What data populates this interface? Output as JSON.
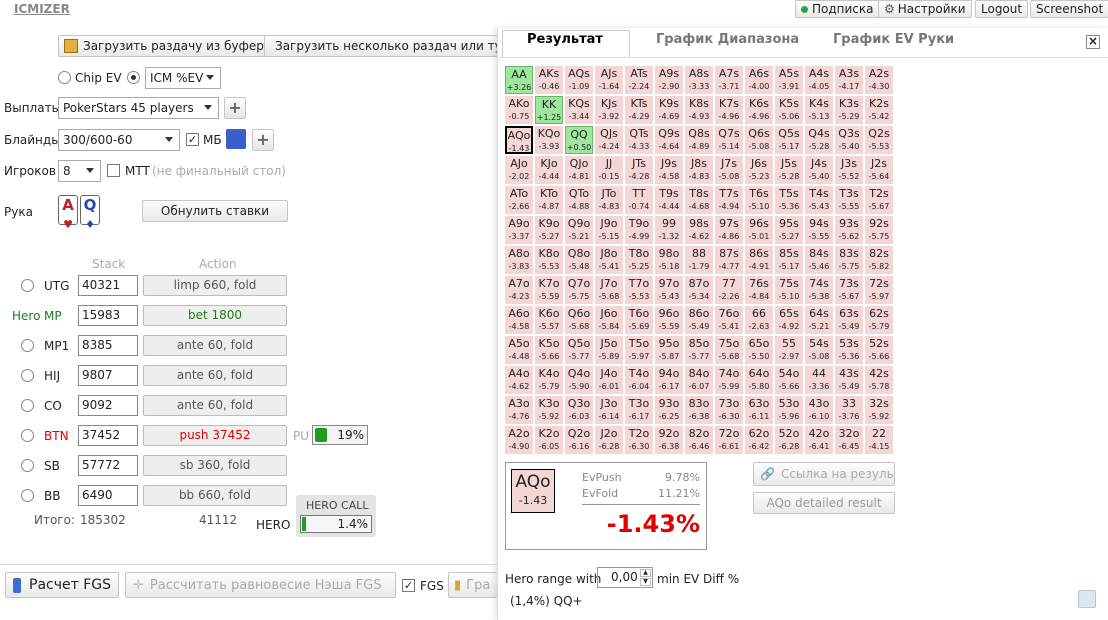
{
  "app": {
    "logo": "ICMIZER"
  },
  "topbar": {
    "subscription": "Подписка",
    "settings": "Настройки",
    "logout": "Logout",
    "screenshot": "Screenshot"
  },
  "left": {
    "load_clipboard": "Загрузить раздачу из буфера",
    "load_multiple": "Загрузить несколько раздач или тур",
    "chip_ev": "Chip EV",
    "icm_ev": "ICM %EV",
    "payouts_label": "Выплаты",
    "payouts_value": "PokerStars 45 players",
    "blinds_label": "Блайнды",
    "blinds_value": "300/600-60",
    "bb_label": "МБ",
    "players_label": "Игроков",
    "players_value": "8",
    "mtt_label": "MTT",
    "mtt_hint": "(не финальный стол)",
    "hand_label": "Рука",
    "card1": "A",
    "card2": "Q",
    "reset_bets": "Обнулить ставки",
    "col_stack": "Stack",
    "col_action": "Action",
    "hero_label": "Hero",
    "positions": [
      {
        "pos": "UTG",
        "stack": "40321",
        "action": "limp 660, fold"
      },
      {
        "pos": "MP",
        "stack": "15983",
        "action": "bet 1800"
      },
      {
        "pos": "MP1",
        "stack": "8385",
        "action": "ante 60, fold"
      },
      {
        "pos": "HIJ",
        "stack": "9807",
        "action": "ante 60, fold"
      },
      {
        "pos": "CO",
        "stack": "9092",
        "action": "ante 60, fold"
      },
      {
        "pos": "BTN",
        "stack": "37452",
        "action": "push 37452"
      },
      {
        "pos": "SB",
        "stack": "57772",
        "action": "sb 360, fold"
      },
      {
        "pos": "BB",
        "stack": "6490",
        "action": "bb 660, fold"
      }
    ],
    "pu_label": "PU",
    "pu_value": "19%",
    "total_label": "Итого:",
    "total_stack": "185302",
    "total_action": "41112",
    "hero_call_label": "HERO CALL",
    "hero_row_label": "HERO",
    "hero_value": "1.4%",
    "calc_fgs": "Расчет FGS",
    "nash_fgs": "Рассчитать равновесие Нэша FGS",
    "fgs_label": "FGS",
    "graph_label": "Гра"
  },
  "panel": {
    "tabs": [
      "Результат",
      "График Диапазона",
      "График EV Руки"
    ],
    "close": "×",
    "link_btn": "Ссылка на результат",
    "detail_btn": "AQo detailed result",
    "result": {
      "hand": "AQo",
      "hand_ev": "-1.43",
      "evpush_label": "EvPush",
      "evpush_value": "9.78%",
      "evfold_label": "EvFold",
      "evfold_value": "11.21%",
      "diff": "-1.43%"
    },
    "range_label": "Hero range with",
    "range_value": "0,00",
    "range_suffix": "min EV Diff %",
    "range_summary": "(1,4%) QQ+",
    "grid": [
      [
        [
          "AA",
          "+3.26"
        ],
        [
          "AKs",
          "-0.46"
        ],
        [
          "AQs",
          "-1.09"
        ],
        [
          "AJs",
          "-1.64"
        ],
        [
          "ATs",
          "-2.24"
        ],
        [
          "A9s",
          "-2.90"
        ],
        [
          "A8s",
          "-3.33"
        ],
        [
          "A7s",
          "-3.71"
        ],
        [
          "A6s",
          "-4.00"
        ],
        [
          "A5s",
          "-3.91"
        ],
        [
          "A4s",
          "-4.05"
        ],
        [
          "A3s",
          "-4.17"
        ],
        [
          "A2s",
          "-4.30"
        ]
      ],
      [
        [
          "AKo",
          "-0.75"
        ],
        [
          "KK",
          "+1.25"
        ],
        [
          "KQs",
          "-3.44"
        ],
        [
          "KJs",
          "-3.92"
        ],
        [
          "KTs",
          "-4.29"
        ],
        [
          "K9s",
          "-4.69"
        ],
        [
          "K8s",
          "-4.93"
        ],
        [
          "K7s",
          "-4.96"
        ],
        [
          "K6s",
          "-4.96"
        ],
        [
          "K5s",
          "-5.06"
        ],
        [
          "K4s",
          "-5.13"
        ],
        [
          "K3s",
          "-5.29"
        ],
        [
          "K2s",
          "-5.42"
        ]
      ],
      [
        [
          "AQo",
          "-1.43"
        ],
        [
          "KQo",
          "-3.93"
        ],
        [
          "QQ",
          "+0.50"
        ],
        [
          "QJs",
          "-4.24"
        ],
        [
          "QTs",
          "-4.33"
        ],
        [
          "Q9s",
          "-4.64"
        ],
        [
          "Q8s",
          "-4.89"
        ],
        [
          "Q7s",
          "-5.14"
        ],
        [
          "Q6s",
          "-5.08"
        ],
        [
          "Q5s",
          "-5.17"
        ],
        [
          "Q4s",
          "-5.28"
        ],
        [
          "Q3s",
          "-5.40"
        ],
        [
          "Q2s",
          "-5.53"
        ]
      ],
      [
        [
          "AJo",
          "-2.02"
        ],
        [
          "KJo",
          "-4.44"
        ],
        [
          "QJo",
          "-4.81"
        ],
        [
          "JJ",
          "-0.15"
        ],
        [
          "JTs",
          "-4.28"
        ],
        [
          "J9s",
          "-4.58"
        ],
        [
          "J8s",
          "-4.83"
        ],
        [
          "J7s",
          "-5.08"
        ],
        [
          "J6s",
          "-5.23"
        ],
        [
          "J5s",
          "-5.28"
        ],
        [
          "J4s",
          "-5.40"
        ],
        [
          "J3s",
          "-5.52"
        ],
        [
          "J2s",
          "-5.64"
        ]
      ],
      [
        [
          "ATo",
          "-2.66"
        ],
        [
          "KTo",
          "-4.87"
        ],
        [
          "QTo",
          "-4.88"
        ],
        [
          "JTo",
          "-4.83"
        ],
        [
          "TT",
          "-0.74"
        ],
        [
          "T9s",
          "-4.44"
        ],
        [
          "T8s",
          "-4.68"
        ],
        [
          "T7s",
          "-4.94"
        ],
        [
          "T6s",
          "-5.10"
        ],
        [
          "T5s",
          "-5.36"
        ],
        [
          "T4s",
          "-5.43"
        ],
        [
          "T3s",
          "-5.55"
        ],
        [
          "T2s",
          "-5.67"
        ]
      ],
      [
        [
          "A9o",
          "-3.37"
        ],
        [
          "K9o",
          "-5.27"
        ],
        [
          "Q9o",
          "-5.21"
        ],
        [
          "J9o",
          "-5.15"
        ],
        [
          "T9o",
          "-4.99"
        ],
        [
          "99",
          "-1.32"
        ],
        [
          "98s",
          "-4.62"
        ],
        [
          "97s",
          "-4.86"
        ],
        [
          "96s",
          "-5.01"
        ],
        [
          "95s",
          "-5.27"
        ],
        [
          "94s",
          "-5.55"
        ],
        [
          "93s",
          "-5.62"
        ],
        [
          "92s",
          "-5.75"
        ]
      ],
      [
        [
          "A8o",
          "-3.83"
        ],
        [
          "K8o",
          "-5.53"
        ],
        [
          "Q8o",
          "-5.48"
        ],
        [
          "J8o",
          "-5.41"
        ],
        [
          "T8o",
          "-5.25"
        ],
        [
          "98o",
          "-5.18"
        ],
        [
          "88",
          "-1.79"
        ],
        [
          "87s",
          "-4.77"
        ],
        [
          "86s",
          "-4.91"
        ],
        [
          "85s",
          "-5.17"
        ],
        [
          "84s",
          "-5.46"
        ],
        [
          "83s",
          "-5.75"
        ],
        [
          "82s",
          "-5.82"
        ]
      ],
      [
        [
          "A7o",
          "-4.23"
        ],
        [
          "K7o",
          "-5.59"
        ],
        [
          "Q7o",
          "-5.75"
        ],
        [
          "J7o",
          "-5.68"
        ],
        [
          "T7o",
          "-5.53"
        ],
        [
          "97o",
          "-5.43"
        ],
        [
          "87o",
          "-5.34"
        ],
        [
          "77",
          "-2.26"
        ],
        [
          "76s",
          "-4.84"
        ],
        [
          "75s",
          "-5.10"
        ],
        [
          "74s",
          "-5.38"
        ],
        [
          "73s",
          "-5.67"
        ],
        [
          "72s",
          "-5.97"
        ]
      ],
      [
        [
          "A6o",
          "-4.58"
        ],
        [
          "K6o",
          "-5.57"
        ],
        [
          "Q6o",
          "-5.68"
        ],
        [
          "J6o",
          "-5.84"
        ],
        [
          "T6o",
          "-5.69"
        ],
        [
          "96o",
          "-5.59"
        ],
        [
          "86o",
          "-5.49"
        ],
        [
          "76o",
          "-5.41"
        ],
        [
          "66",
          "-2.63"
        ],
        [
          "65s",
          "-4.92"
        ],
        [
          "64s",
          "-5.21"
        ],
        [
          "63s",
          "-5.49"
        ],
        [
          "62s",
          "-5.79"
        ]
      ],
      [
        [
          "A5o",
          "-4.48"
        ],
        [
          "K5o",
          "-5.66"
        ],
        [
          "Q5o",
          "-5.77"
        ],
        [
          "J5o",
          "-5.89"
        ],
        [
          "T5o",
          "-5.97"
        ],
        [
          "95o",
          "-5.87"
        ],
        [
          "85o",
          "-5.77"
        ],
        [
          "75o",
          "-5.68"
        ],
        [
          "65o",
          "-5.50"
        ],
        [
          "55",
          "-2.97"
        ],
        [
          "54s",
          "-5.08"
        ],
        [
          "53s",
          "-5.36"
        ],
        [
          "52s",
          "-5.66"
        ]
      ],
      [
        [
          "A4o",
          "-4.62"
        ],
        [
          "K4o",
          "-5.79"
        ],
        [
          "Q4o",
          "-5.90"
        ],
        [
          "J4o",
          "-6.01"
        ],
        [
          "T4o",
          "-6.04"
        ],
        [
          "94o",
          "-6.17"
        ],
        [
          "84o",
          "-6.07"
        ],
        [
          "74o",
          "-5.99"
        ],
        [
          "64o",
          "-5.80"
        ],
        [
          "54o",
          "-5.66"
        ],
        [
          "44",
          "-3.36"
        ],
        [
          "43s",
          "-5.49"
        ],
        [
          "42s",
          "-5.78"
        ]
      ],
      [
        [
          "A3o",
          "-4.76"
        ],
        [
          "K3o",
          "-5.92"
        ],
        [
          "Q3o",
          "-6.03"
        ],
        [
          "J3o",
          "-6.14"
        ],
        [
          "T3o",
          "-6.17"
        ],
        [
          "93o",
          "-6.25"
        ],
        [
          "83o",
          "-6.38"
        ],
        [
          "73o",
          "-6.30"
        ],
        [
          "63o",
          "-6.11"
        ],
        [
          "53o",
          "-5.96"
        ],
        [
          "43o",
          "-6.10"
        ],
        [
          "33",
          "-3.76"
        ],
        [
          "32s",
          "-5.92"
        ]
      ],
      [
        [
          "A2o",
          "-4.90"
        ],
        [
          "K2o",
          "-6.05"
        ],
        [
          "Q2o",
          "-6.16"
        ],
        [
          "J2o",
          "-6.28"
        ],
        [
          "T2o",
          "-6.30"
        ],
        [
          "92o",
          "-6.38"
        ],
        [
          "82o",
          "-6.46"
        ],
        [
          "72o",
          "-6.61"
        ],
        [
          "62o",
          "-6.42"
        ],
        [
          "52o",
          "-6.28"
        ],
        [
          "42o",
          "-6.41"
        ],
        [
          "32o",
          "-6.45"
        ],
        [
          "22",
          "-4.15"
        ]
      ]
    ]
  },
  "colors": {
    "in_range": "#9fe69f",
    "out_range": "#f4d6d6",
    "push_red": "#e00000",
    "hero_green": "#1f7a1f"
  }
}
